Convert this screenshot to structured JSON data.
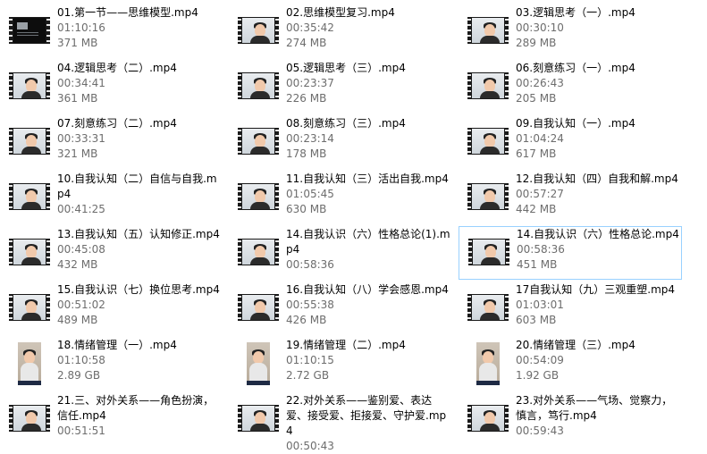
{
  "files": [
    {
      "name": "01.第一节——思维模型.mp4",
      "duration": "01:10:16",
      "size": "371 MB",
      "thumb": "dark"
    },
    {
      "name": "02.思维模型复习.mp4",
      "duration": "00:35:42",
      "size": "274 MB",
      "thumb": "video"
    },
    {
      "name": "03.逻辑思考（一）.mp4",
      "duration": "00:30:10",
      "size": "289 MB",
      "thumb": "video"
    },
    {
      "name": "04.逻辑思考（二）.mp4",
      "duration": "00:34:41",
      "size": "361 MB",
      "thumb": "video"
    },
    {
      "name": "05.逻辑思考（三）.mp4",
      "duration": "00:23:37",
      "size": "226 MB",
      "thumb": "video"
    },
    {
      "name": "06.刻意练习（一）.mp4",
      "duration": "00:26:43",
      "size": "205 MB",
      "thumb": "video"
    },
    {
      "name": "07.刻意练习（二）.mp4",
      "duration": "00:33:31",
      "size": "321 MB",
      "thumb": "video"
    },
    {
      "name": "08.刻意练习（三）.mp4",
      "duration": "00:23:14",
      "size": "178 MB",
      "thumb": "video"
    },
    {
      "name": "09.自我认知（一）.mp4",
      "duration": "01:04:24",
      "size": "617 MB",
      "thumb": "video"
    },
    {
      "name": "10.自我认知（二）自信与自我.mp4",
      "duration": "00:41:25",
      "size": "",
      "thumb": "video"
    },
    {
      "name": "11.自我认知（三）活出自我.mp4",
      "duration": "01:05:45",
      "size": "630 MB",
      "thumb": "video"
    },
    {
      "name": "12.自我认知（四）自我和解.mp4",
      "duration": "00:57:27",
      "size": "442 MB",
      "thumb": "video"
    },
    {
      "name": "13.自我认知（五）认知修正.mp4",
      "duration": "00:45:08",
      "size": "432 MB",
      "thumb": "video"
    },
    {
      "name": "14.自我认识（六）性格总论(1).mp4",
      "duration": "00:58:36",
      "size": "",
      "thumb": "video"
    },
    {
      "name": "14.自我认识（六）性格总论.mp4",
      "duration": "00:58:36",
      "size": "451 MB",
      "thumb": "video",
      "selected": true
    },
    {
      "name": "15.自我认识（七）换位思考.mp4",
      "duration": "00:51:02",
      "size": "489 MB",
      "thumb": "video"
    },
    {
      "name": "16.自我认知（八）学会感恩.mp4",
      "duration": "00:55:38",
      "size": "426 MB",
      "thumb": "video"
    },
    {
      "name": "17自我认知（九）三观重塑.mp4",
      "duration": "01:03:01",
      "size": "603 MB",
      "thumb": "video"
    },
    {
      "name": "18.情绪管理（一）.mp4",
      "duration": "01:10:58",
      "size": "2.89 GB",
      "thumb": "portrait"
    },
    {
      "name": "19.情绪管理（二）.mp4",
      "duration": "01:10:15",
      "size": "2.72 GB",
      "thumb": "portrait"
    },
    {
      "name": "20.情绪管理（三）.mp4",
      "duration": "00:54:09",
      "size": "1.92 GB",
      "thumb": "portrait"
    },
    {
      "name": "21.三、对外关系——角色扮演，信任.mp4",
      "duration": "00:51:51",
      "size": "",
      "thumb": "video"
    },
    {
      "name": "22.对外关系——鉴别爱、表达爱、接受爱、拒接爱、守护爱.mp4",
      "duration": "00:50:43",
      "size": "",
      "thumb": "video"
    },
    {
      "name": "23.对外关系——气场、觉察力，慎言，笃行.mp4",
      "duration": "00:59:43",
      "size": "",
      "thumb": "video"
    }
  ]
}
